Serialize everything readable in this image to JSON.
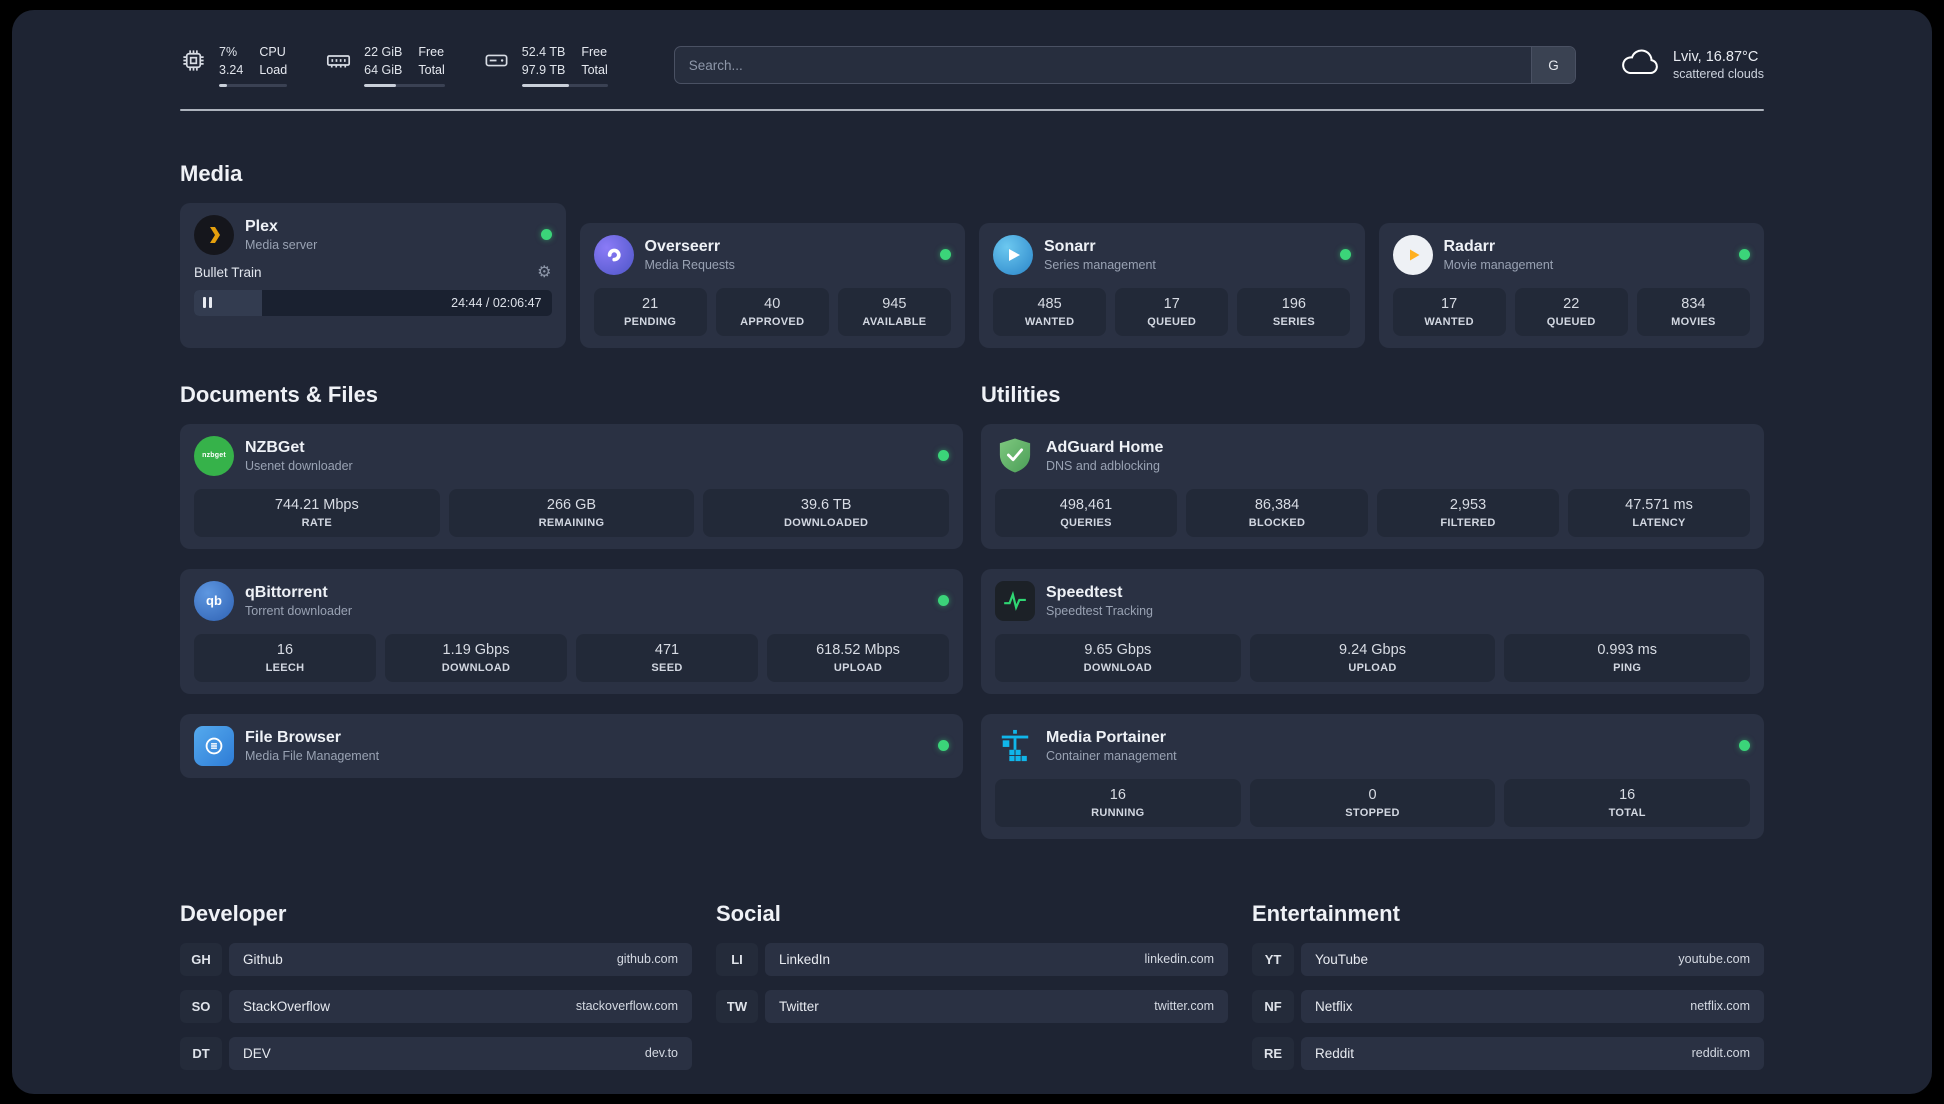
{
  "topbar": {
    "cpu": {
      "value1": "7%",
      "value2": "3.24",
      "label1": "CPU",
      "label2": "Load",
      "bar_percent": 12
    },
    "ram": {
      "value1": "22 GiB",
      "value2": "64 GiB",
      "label1": "Free",
      "label2": "Total",
      "bar_percent": 40
    },
    "disk": {
      "value1": "52.4 TB",
      "value2": "97.9 TB",
      "label1": "Free",
      "label2": "Total",
      "bar_percent": 55
    },
    "search": {
      "placeholder": "Search...",
      "engine": "G"
    },
    "weather": {
      "line1": "Lviv, 16.87°C",
      "line2": "scattered clouds"
    }
  },
  "sections": {
    "media": {
      "title": "Media",
      "plex": {
        "name": "Plex",
        "desc": "Media server",
        "track": "Bullet Train",
        "time": "24:44 / 02:06:47",
        "progress_percent": 19
      },
      "overseerr": {
        "name": "Overseerr",
        "desc": "Media Requests",
        "stats": [
          {
            "value": "21",
            "label": "PENDING"
          },
          {
            "value": "40",
            "label": "APPROVED"
          },
          {
            "value": "945",
            "label": "AVAILABLE"
          }
        ]
      },
      "sonarr": {
        "name": "Sonarr",
        "desc": "Series management",
        "stats": [
          {
            "value": "485",
            "label": "WANTED"
          },
          {
            "value": "17",
            "label": "QUEUED"
          },
          {
            "value": "196",
            "label": "SERIES"
          }
        ]
      },
      "radarr": {
        "name": "Radarr",
        "desc": "Movie management",
        "stats": [
          {
            "value": "17",
            "label": "WANTED"
          },
          {
            "value": "22",
            "label": "QUEUED"
          },
          {
            "value": "834",
            "label": "MOVIES"
          }
        ]
      }
    },
    "documents": {
      "title": "Documents & Files",
      "nzbget": {
        "name": "NZBGet",
        "desc": "Usenet downloader",
        "icon_text": "nzbget",
        "stats": [
          {
            "value": "744.21 Mbps",
            "label": "RATE"
          },
          {
            "value": "266 GB",
            "label": "REMAINING"
          },
          {
            "value": "39.6 TB",
            "label": "DOWNLOADED"
          }
        ]
      },
      "qbittorrent": {
        "name": "qBittorrent",
        "desc": "Torrent downloader",
        "icon_text": "qb",
        "stats": [
          {
            "value": "16",
            "label": "LEECH"
          },
          {
            "value": "1.19 Gbps",
            "label": "DOWNLOAD"
          },
          {
            "value": "471",
            "label": "SEED"
          },
          {
            "value": "618.52 Mbps",
            "label": "UPLOAD"
          }
        ]
      },
      "filebrowser": {
        "name": "File Browser",
        "desc": "Media File Management"
      }
    },
    "utilities": {
      "title": "Utilities",
      "adguard": {
        "name": "AdGuard Home",
        "desc": "DNS and adblocking",
        "stats": [
          {
            "value": "498,461",
            "label": "QUERIES"
          },
          {
            "value": "86,384",
            "label": "BLOCKED"
          },
          {
            "value": "2,953",
            "label": "FILTERED"
          },
          {
            "value": "47.571 ms",
            "label": "LATENCY"
          }
        ]
      },
      "speedtest": {
        "name": "Speedtest",
        "desc": "Speedtest Tracking",
        "stats": [
          {
            "value": "9.65 Gbps",
            "label": "DOWNLOAD"
          },
          {
            "value": "9.24 Gbps",
            "label": "UPLOAD"
          },
          {
            "value": "0.993 ms",
            "label": "PING"
          }
        ]
      },
      "portainer": {
        "name": "Media Portainer",
        "desc": "Container management",
        "stats": [
          {
            "value": "16",
            "label": "RUNNING"
          },
          {
            "value": "0",
            "label": "STOPPED"
          },
          {
            "value": "16",
            "label": "TOTAL"
          }
        ]
      }
    },
    "bookmarks": {
      "developer": {
        "title": "Developer",
        "items": [
          {
            "abbr": "GH",
            "name": "Github",
            "url": "github.com"
          },
          {
            "abbr": "SO",
            "name": "StackOverflow",
            "url": "stackoverflow.com"
          },
          {
            "abbr": "DT",
            "name": "DEV",
            "url": "dev.to"
          }
        ]
      },
      "social": {
        "title": "Social",
        "items": [
          {
            "abbr": "LI",
            "name": "LinkedIn",
            "url": "linkedin.com"
          },
          {
            "abbr": "TW",
            "name": "Twitter",
            "url": "twitter.com"
          }
        ]
      },
      "entertainment": {
        "title": "Entertainment",
        "items": [
          {
            "abbr": "YT",
            "name": "YouTube",
            "url": "youtube.com"
          },
          {
            "abbr": "NF",
            "name": "Netflix",
            "url": "netflix.com"
          },
          {
            "abbr": "RE",
            "name": "Reddit",
            "url": "reddit.com"
          }
        ]
      }
    }
  },
  "colors": {
    "status_online": "#3bd479",
    "plex_accent": "#e5a00d"
  }
}
